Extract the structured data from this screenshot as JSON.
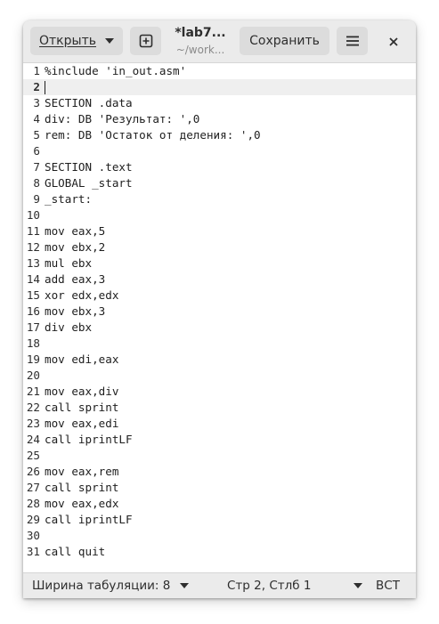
{
  "header": {
    "open_label": "Открыть",
    "save_label": "Сохранить",
    "title": "*lab7...",
    "subtitle": "~/work..."
  },
  "editor": {
    "current_line": 2,
    "lines": [
      "%include 'in_out.asm'",
      "",
      "SECTION .data",
      "div: DB 'Результат: ',0",
      "rem: DB 'Остаток от деления: ',0",
      "",
      "SECTION .text",
      "GLOBAL _start",
      "_start:",
      "",
      "mov eax,5",
      "mov ebx,2",
      "mul ebx",
      "add eax,3",
      "xor edx,edx",
      "mov ebx,3",
      "div ebx",
      "",
      "mov edi,eax",
      "",
      "mov eax,div",
      "call sprint",
      "mov eax,edi",
      "call iprintLF",
      "",
      "mov eax,rem",
      "call sprint",
      "mov eax,edx",
      "call iprintLF",
      "",
      "call quit"
    ]
  },
  "statusbar": {
    "tab_width_label": "Ширина табуляции: 8",
    "position_label": "Стр 2, Стлб 1",
    "insert_mode": "ВСТ"
  },
  "icons": {
    "open_dropdown": "chevron-down-icon",
    "new_tab": "new-tab-icon",
    "menu": "hamburger-menu-icon",
    "close": "close-icon"
  }
}
